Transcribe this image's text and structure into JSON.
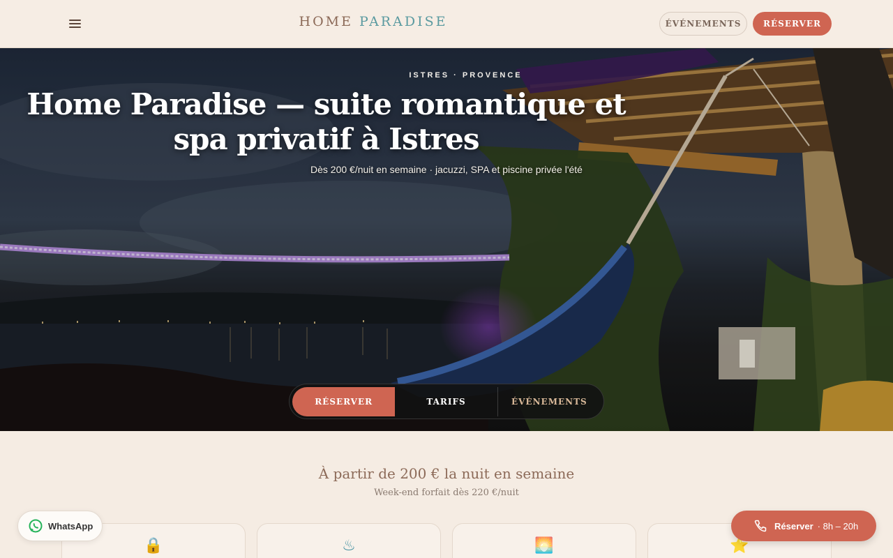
{
  "header": {
    "menu_icon": "hamburger-menu-icon",
    "brand_part1": "HOME",
    "brand_part2": "PARADISE",
    "events_label": "ÉVÉNEMENTS",
    "book_label": "RÉSERVER"
  },
  "hero": {
    "eyebrow": "ISTRES · PROVENCE",
    "title": "Home Paradise — suite romantique et spa privatif à Istres",
    "subtitle": "Dès 200 €/nuit en semaine · jacuzzi, SPA et piscine privée l'été",
    "segments": {
      "book": "RÉSERVER",
      "tarifs": "TARIFS",
      "events": "ÉVÉNEMENTS"
    }
  },
  "pricing": {
    "title": "À partir de 200 € la nuit en semaine",
    "subtitle": "Week-end forfait dès 220 €/nuit"
  },
  "cards": [
    {
      "icon": "lock-icon",
      "glyph": "🔒"
    },
    {
      "icon": "hot-tub-icon",
      "glyph": "♨"
    },
    {
      "icon": "pool-icon",
      "glyph": "🌅"
    },
    {
      "icon": "star-icon",
      "glyph": "⭐"
    }
  ],
  "floating": {
    "whatsapp_label": "WhatsApp",
    "book_label": "Réserver",
    "book_hours": "· 8h – 20h"
  },
  "colors": {
    "accent": "#cf6552",
    "brand_brown": "#8c6a58",
    "brand_teal": "#5a9aa0",
    "background": "#f5ece3"
  }
}
